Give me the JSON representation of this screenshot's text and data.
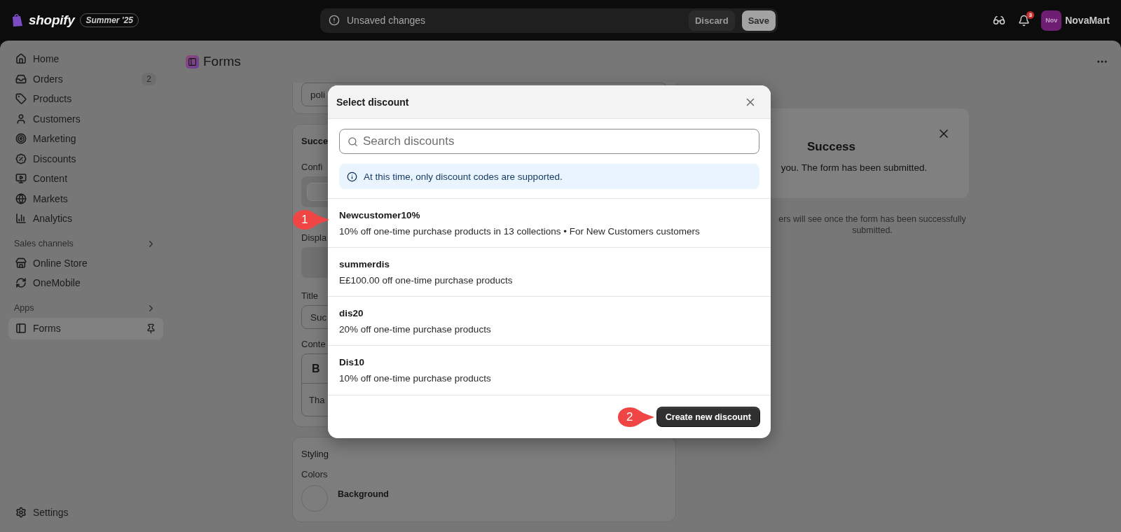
{
  "topbar": {
    "brand": "shopify",
    "edition": "Summer '25",
    "unsaved": {
      "message": "Unsaved changes",
      "buttons": [
        {
          "label": "Discard",
          "kind": "secondary"
        },
        {
          "label": "Save",
          "kind": "primary"
        }
      ]
    },
    "notifications": {
      "count": "3"
    },
    "account": {
      "initials": "Nov",
      "name": "NovaMart"
    }
  },
  "sidebar": {
    "items": [
      {
        "label": "Home",
        "selected": false
      },
      {
        "label": "Orders",
        "badge": "2",
        "selected": false
      },
      {
        "label": "Products",
        "selected": false
      },
      {
        "label": "Customers",
        "selected": false
      },
      {
        "label": "Marketing",
        "selected": false
      },
      {
        "label": "Discounts",
        "selected": false
      },
      {
        "label": "Content",
        "selected": false
      },
      {
        "label": "Markets",
        "selected": false
      },
      {
        "label": "Analytics",
        "selected": false
      }
    ],
    "sections": [
      {
        "title": "Sales channels",
        "items": [
          {
            "label": "Online Store",
            "selected": false
          },
          {
            "label": "OneMobile",
            "selected": false
          }
        ]
      },
      {
        "title": "Apps",
        "items": [
          {
            "label": "Forms",
            "selected": true,
            "pinned": true
          }
        ]
      }
    ],
    "footer": {
      "label": "Settings"
    }
  },
  "page": {
    "title": "Forms",
    "editor": {
      "policy_field": {
        "value": "poli"
      },
      "success_card": {
        "heading": "Succe",
        "confirmation_label": "Confi",
        "display_label": "Displa",
        "title_label": "Title",
        "title_field": {
          "value": "Suc"
        },
        "content_label": "Conte",
        "toolbar_bold": "B",
        "content_text": "Tha"
      },
      "styling_card": {
        "heading": "Styling",
        "colors_label": "Colors",
        "background_label": "Background"
      }
    },
    "preview": {
      "title": "Success",
      "message": "you. The form has been submitted.",
      "help_text": "ers will see once the form has been successfully submitted."
    }
  },
  "dialog": {
    "title": "Select discount",
    "search": {
      "placeholder": "Search discounts"
    },
    "notice": "At this time, only discount codes are supported.",
    "discounts": [
      {
        "code": "Newcustomer10%",
        "summary": "10% off one-time purchase products in 13 collections • For New Customers customers"
      },
      {
        "code": "summerdis",
        "summary": "E£100.00 off one-time purchase products"
      },
      {
        "code": "dis20",
        "summary": "20% off one-time purchase products"
      },
      {
        "code": "Dis10",
        "summary": "10% off one-time purchase products"
      }
    ],
    "button": "Create new discount"
  },
  "annotations": [
    {
      "label": "1"
    },
    {
      "label": "2"
    }
  ]
}
